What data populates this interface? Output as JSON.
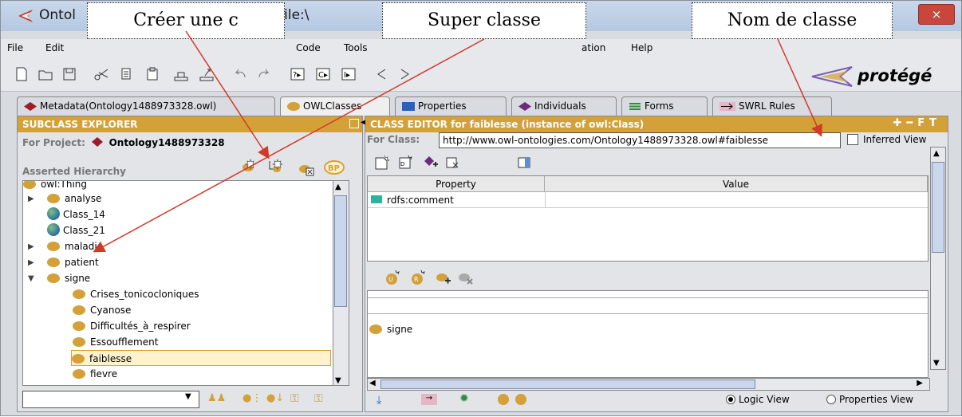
{
  "window": {
    "title": "Ontol                                      .5     (file:\\                                  uments\\Ontc",
    "close": "×"
  },
  "menu": [
    {
      "label": "File"
    },
    {
      "label": "Edit"
    },
    {
      "label": "Code"
    },
    {
      "label": "Tools"
    },
    {
      "label": "ation"
    },
    {
      "label": "Help"
    }
  ],
  "logo": "protégé",
  "tabs": [
    {
      "label": "Metadata(Ontology1488973328.owl)"
    },
    {
      "label": "OWLClasses"
    },
    {
      "label": "Properties"
    },
    {
      "label": "Individuals"
    },
    {
      "label": "Forms"
    },
    {
      "label": "SWRL Rules"
    }
  ],
  "left": {
    "header": "SUBCLASS EXPLORER",
    "project_label": "For Project:",
    "project_name": "Ontology148897332­8",
    "hierarchy_label": "Asserted Hierarchy",
    "tree": [
      {
        "label": "owl:Thing"
      },
      {
        "label": "analyse"
      },
      {
        "label": "Class_14"
      },
      {
        "label": "Class_21"
      },
      {
        "label": "maladie"
      },
      {
        "label": "patient"
      },
      {
        "label": "signe"
      },
      {
        "label": "Crises_tonicocloniques"
      },
      {
        "label": "Cyanose"
      },
      {
        "label": "Difficultés_à_respirer"
      },
      {
        "label": "Essoufflement"
      },
      {
        "label": "faiblesse"
      },
      {
        "label": "fievre"
      }
    ]
  },
  "right": {
    "header": "CLASS EDITOR for faiblesse   (instance of owl:Class)",
    "for_class_label": "For Class:",
    "for_class_value": "http://www.owl-ontologies.com/Ontology1488973328.owl#faiblesse",
    "inferred_view": "Inferred View",
    "col_property": "Property",
    "col_value": "Value",
    "row_property": "rdfs:comment",
    "superclass": "signe",
    "logic_view": "Logic View",
    "properties_view": "Properties View"
  },
  "callouts": {
    "create": "Créer une c",
    "superclass": "Super classe",
    "classname": "Nom de classe"
  },
  "colors": {
    "accent": "#d4a038",
    "header_text": "#ffffff",
    "arrow": "#d03a2a"
  }
}
